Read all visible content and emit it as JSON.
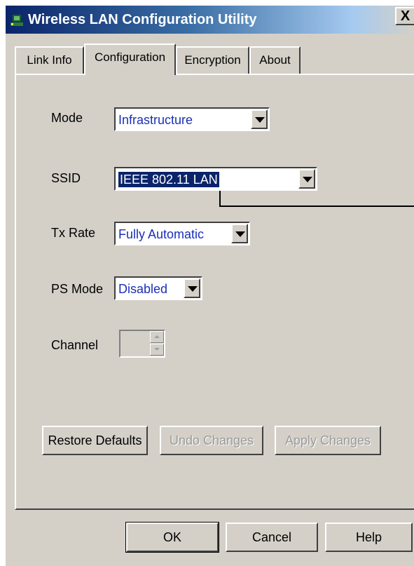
{
  "window": {
    "title": "Wireless LAN Configuration Utility",
    "close_glyph": "X",
    "icon": "wireless-network-icon"
  },
  "tabs": [
    {
      "label": "Link Info",
      "active": false
    },
    {
      "label": "Configuration",
      "active": true
    },
    {
      "label": "Encryption",
      "active": false
    },
    {
      "label": "About",
      "active": false
    }
  ],
  "form": {
    "mode": {
      "label": "Mode",
      "value": "Infrastructure"
    },
    "ssid": {
      "label": "SSID",
      "value": "IEEE 802.11 LAN"
    },
    "tx_rate": {
      "label": "Tx Rate",
      "value": "Fully Automatic"
    },
    "ps_mode": {
      "label": "PS Mode",
      "value": "Disabled"
    },
    "channel": {
      "label": "Channel",
      "value": ""
    }
  },
  "panel_buttons": {
    "restore": "Restore Defaults",
    "undo": "Undo Changes",
    "apply": "Apply Changes"
  },
  "dialog_buttons": {
    "ok": "OK",
    "cancel": "Cancel",
    "help": "Help"
  },
  "colors": {
    "title_start": "#0a246a",
    "face": "#d4d0c8",
    "value_text": "#1a2fb8",
    "selection": "#0a246a"
  }
}
